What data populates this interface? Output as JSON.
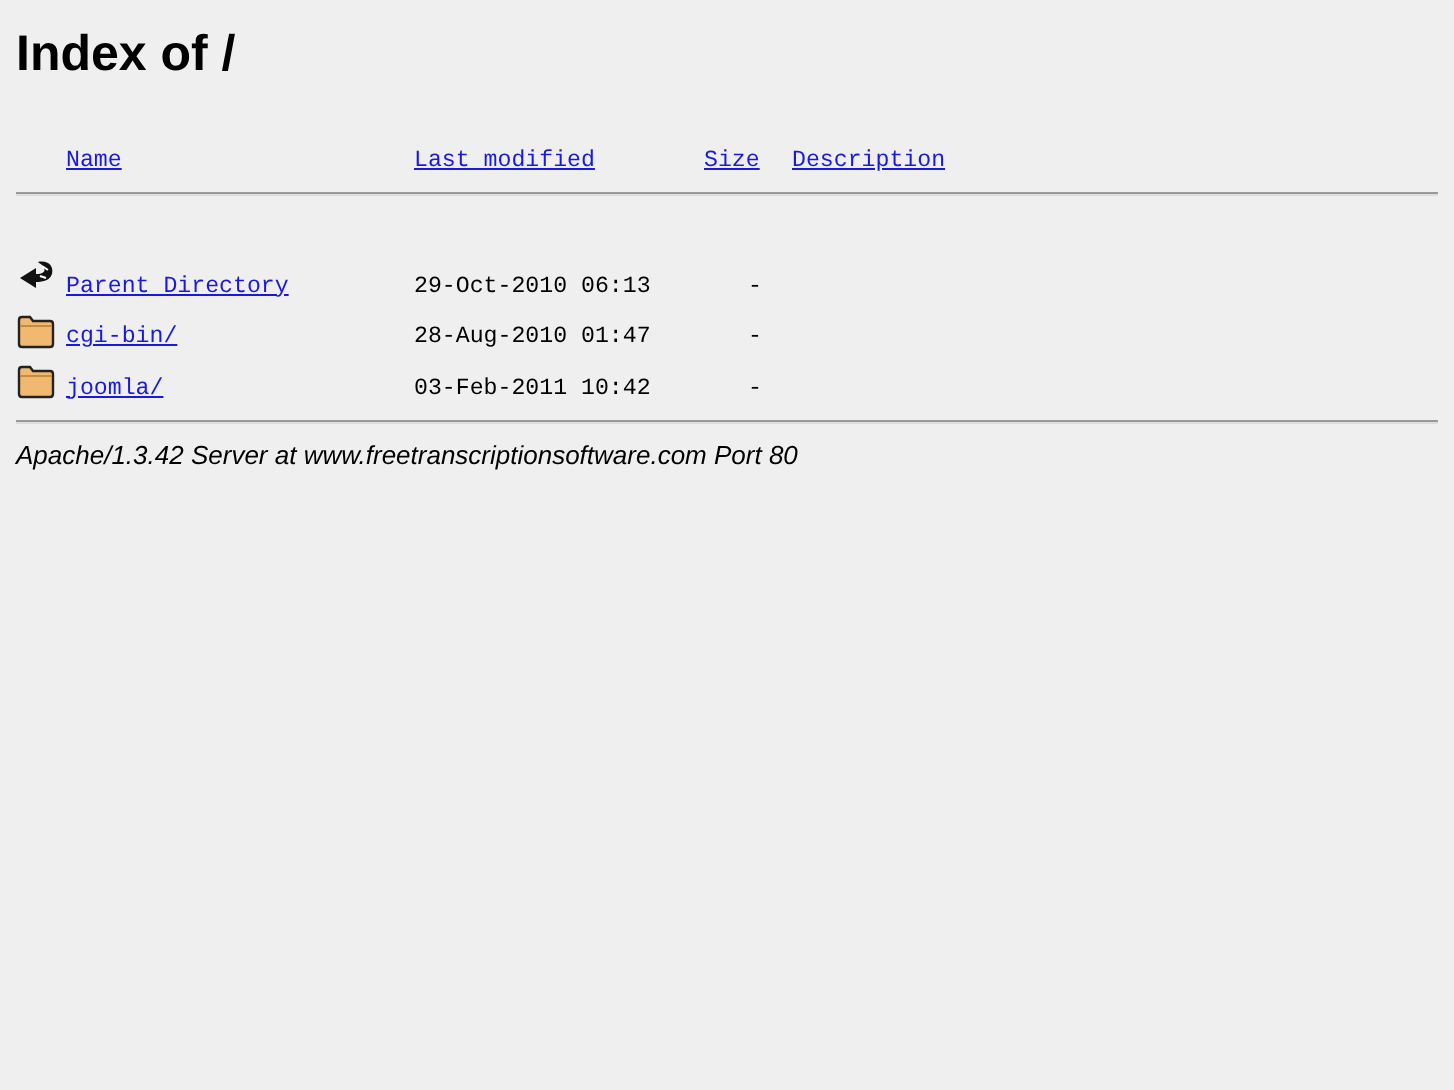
{
  "title": "Index of /",
  "columns": [
    "Name",
    "Last modified",
    "Size",
    "Description"
  ],
  "rows": [
    {
      "kind": "parent",
      "name": "Parent Directory",
      "modified": "29-Oct-2010 06:13",
      "size": "-"
    },
    {
      "kind": "folder",
      "name": "cgi-bin/",
      "modified": "28-Aug-2010 01:47",
      "size": "-"
    },
    {
      "kind": "folder",
      "name": "joomla/",
      "modified": "03-Feb-2011 10:42",
      "size": "-"
    }
  ],
  "address": "Apache/1.3.42 Server at www.freetranscriptionsoftware.com Port 80"
}
